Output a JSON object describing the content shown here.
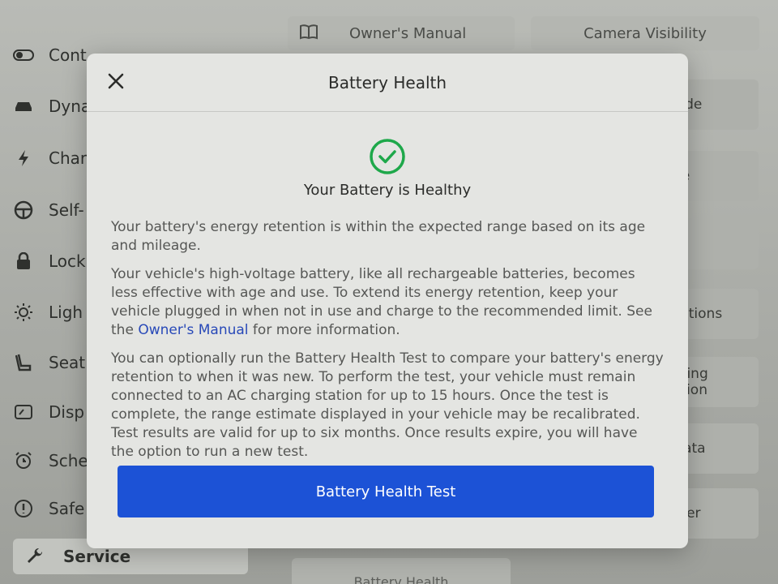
{
  "background": {
    "sidebar_items": [
      {
        "label": "Cont",
        "icon": "toggle-icon"
      },
      {
        "label": "Dyna",
        "icon": "car-icon"
      },
      {
        "label": "Char",
        "icon": "lightning-icon"
      },
      {
        "label": "Self-",
        "icon": "steering-wheel-icon"
      },
      {
        "label": "Lock",
        "icon": "lock-icon"
      },
      {
        "label": "Ligh",
        "icon": "sun-icon"
      },
      {
        "label": "Seat",
        "icon": "seat-icon"
      },
      {
        "label": "Disp",
        "icon": "display-icon"
      },
      {
        "label": "Sche",
        "icon": "alarm-clock-icon"
      },
      {
        "label": "Safe",
        "icon": "info-circle-icon"
      },
      {
        "label": "Service",
        "icon": "wrench-icon"
      }
    ],
    "top_buttons": {
      "owners_manual": "Owner's Manual",
      "camera_visibility": "Camera Visibility"
    },
    "right_cards": [
      "lode",
      "de",
      "",
      "cations",
      "ering\nation",
      "Data",
      "ater"
    ],
    "bottom_card": "Battery Health"
  },
  "modal": {
    "title": "Battery Health",
    "status_icon": "check-circle-icon",
    "status_text": "Your Battery is Healthy",
    "paragraph1": "Your battery's energy retention is within the expected range based on its age and mileage.",
    "paragraph2_pre": "Your vehicle's high-voltage battery, like all rechargeable batteries, becomes less effective with age and use. To extend its energy retention, keep your vehicle plugged in when not in use and charge to the recommended limit. See the ",
    "paragraph2_link": "Owner's Manual",
    "paragraph2_post": " for more information.",
    "paragraph3": "You can optionally run the Battery Health Test to compare your battery's energy retention to when it was new. To perform the test, your vehicle must remain connected to an AC charging station for up to 15 hours. Once the test is complete, the range estimate displayed in your vehicle may be recalibrated. Test results are valid for up to six months. Once results expire, you will have the option to run a new test.",
    "primary_button": "Battery Health Test"
  },
  "colors": {
    "accent": "#1c52d6",
    "link": "#2849b8",
    "success": "#1ea84a",
    "modal_bg": "#e4e5e2"
  }
}
